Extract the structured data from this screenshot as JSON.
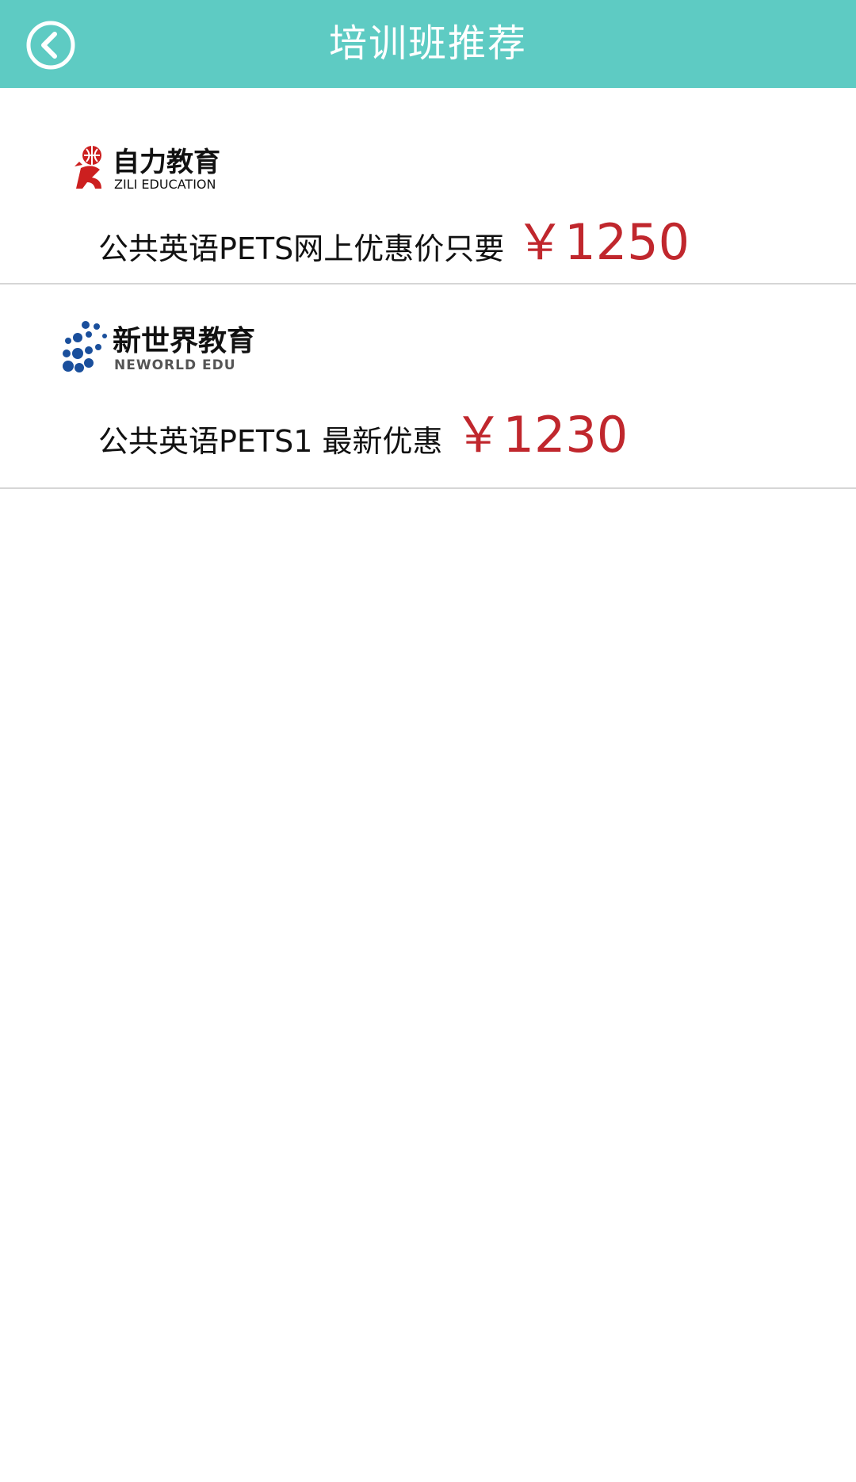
{
  "header": {
    "title": "培训班推荐",
    "back_icon": "chevron-left-circle-icon",
    "background_color": "#5ecbc3"
  },
  "courses": [
    {
      "logo": {
        "cn_text": "自力教育",
        "en_text": "ZILI EDUCATION",
        "color": "#cc1f1f"
      },
      "description": "公共英语PETS网上优惠价只要",
      "price": "￥1250"
    },
    {
      "logo": {
        "cn_text": "新世界教育",
        "en_text": "NEWORLD EDU",
        "color": "#1a4f9c"
      },
      "description": "公共英语PETS1 最新优惠",
      "price": "￥1230"
    }
  ],
  "colors": {
    "price": "#c0272d",
    "divider": "#d6d6d6"
  }
}
